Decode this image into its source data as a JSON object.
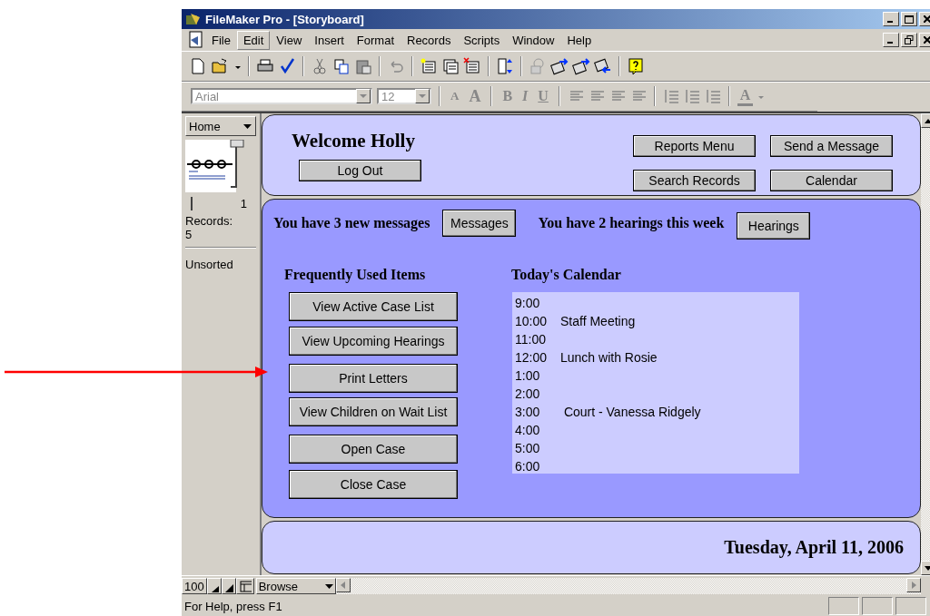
{
  "window": {
    "title": "FileMaker Pro - [Storyboard]"
  },
  "menu": [
    {
      "label": "File",
      "selected": false
    },
    {
      "label": "Edit",
      "selected": true
    },
    {
      "label": "View",
      "selected": false
    },
    {
      "label": "Insert",
      "selected": false
    },
    {
      "label": "Format",
      "selected": false
    },
    {
      "label": "Records",
      "selected": false
    },
    {
      "label": "Scripts",
      "selected": false
    },
    {
      "label": "Window",
      "selected": false
    },
    {
      "label": "Help",
      "selected": false
    }
  ],
  "format_bar": {
    "font": "Arial",
    "size": "12",
    "grow_labels": [
      "A",
      "A"
    ],
    "style_buttons": [
      "B",
      "I",
      "U"
    ],
    "text_color_label": "A"
  },
  "sidebar": {
    "layout": "Home",
    "record": "1",
    "records_label": "Records:",
    "records_count": "5",
    "sort_status": "Unsorted"
  },
  "header": {
    "welcome": "Welcome Holly",
    "logout": "Log Out",
    "buttons": [
      "Reports Menu",
      "Send a Message",
      "Search Records",
      "Calendar"
    ]
  },
  "notices": [
    {
      "text": "You have 3 new messages",
      "button": "Messages"
    },
    {
      "text": "You have 2 hearings this week",
      "button": "Hearings"
    }
  ],
  "frequent": {
    "title": "Frequently Used Items",
    "buttons": [
      "View Active Case List",
      "View Upcoming Hearings",
      "Print Letters",
      "View Children on Wait List",
      "Open Case",
      "Close Case"
    ]
  },
  "calendar": {
    "title": "Today's Calendar",
    "entries": [
      {
        "time": "9:00"
      },
      {
        "time": "10:00",
        "event": "Staff Meeting"
      },
      {
        "time": "11:00"
      },
      {
        "time": "12:00",
        "event": "Lunch with Rosie"
      },
      {
        "time": "1:00"
      },
      {
        "time": "2:00"
      },
      {
        "time": "3:00",
        "event": " Court - Vanessa Ridgely"
      },
      {
        "time": "4:00"
      },
      {
        "time": "5:00"
      },
      {
        "time": "6:00"
      }
    ]
  },
  "footer": {
    "date": "Tuesday, April 11, 2006"
  },
  "bottom_bar": {
    "zoom": "100",
    "mode": "Browse"
  },
  "status_bar": {
    "text": "For Help, press F1"
  }
}
